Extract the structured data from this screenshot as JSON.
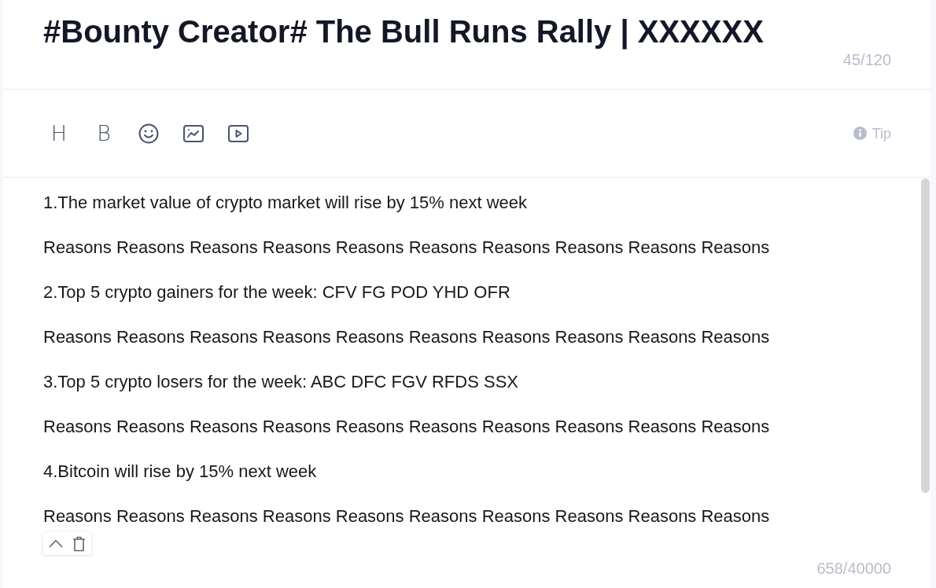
{
  "title": {
    "text": "#Bounty Creator# The Bull Runs Rally | XXXXXX",
    "counter": "45/120"
  },
  "toolbar": {
    "tools": [
      {
        "kind": "heading",
        "label": "H"
      },
      {
        "kind": "bold",
        "label": "B"
      },
      {
        "kind": "emoji"
      },
      {
        "kind": "image"
      },
      {
        "kind": "video"
      }
    ],
    "tip": "Tip"
  },
  "content": {
    "paragraphs": [
      "1.The market value of crypto market will rise by 15% next week",
      "Reasons Reasons Reasons Reasons Reasons Reasons Reasons Reasons Reasons Reasons",
      "2.Top 5 crypto gainers for the week: CFV FG POD YHD OFR",
      "Reasons Reasons Reasons Reasons Reasons Reasons Reasons Reasons Reasons Reasons",
      "3.Top 5 crypto losers for the week: ABC DFC FGV RFDS SSX",
      "Reasons Reasons Reasons Reasons Reasons Reasons Reasons Reasons Reasons Reasons",
      "4.Bitcoin will rise by 15% next week",
      "Reasons Reasons Reasons Reasons Reasons Reasons Reasons Reasons Reasons Reasons"
    ],
    "counter": "658/40000"
  },
  "block_menu": {
    "actions": [
      {
        "kind": "move-up"
      },
      {
        "kind": "delete"
      }
    ]
  }
}
